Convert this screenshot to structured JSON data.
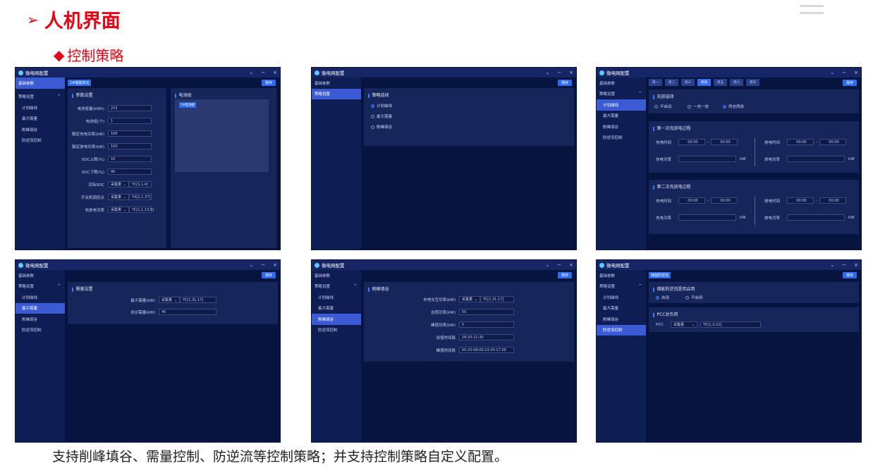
{
  "heading": {
    "arrow": "➢",
    "title": "人机界面"
  },
  "subheading": {
    "diamond": "◆",
    "title": "控制策略"
  },
  "caption": "支持削峰填谷、需量控制、防逆流等控制策略；并支持控制策略自定义配置。",
  "window": {
    "title": "微电网配置",
    "min": "−",
    "close": "×",
    "collapse": "⌄"
  },
  "sidebar": {
    "basic": "基础参数",
    "strategy": "策略设置",
    "plan": "计划曲线",
    "demand": "最大需量",
    "peak": "削峰填谷",
    "reverse": "防逆流控制"
  },
  "save": "保存",
  "w1": {
    "tag": "1#储能单元",
    "param_title": "参数设置",
    "group_title": "电池组",
    "group_btn": "1#电池组",
    "fields": [
      {
        "label": "电池容量(kWh)",
        "value": "215"
      },
      {
        "label": "电池组(个)",
        "value": "1"
      },
      {
        "label": "额定充电功率(kW)",
        "value": "100"
      },
      {
        "label": "额定放电功率(kW)",
        "value": "100"
      },
      {
        "label": "SOC上限(%)",
        "value": "10"
      },
      {
        "label": "SOC下限(%)",
        "value": "90"
      }
    ],
    "selects": [
      {
        "label": "实际SOC",
        "type": "采集量",
        "value": "YC[1,1,4]"
      },
      {
        "label": "开关机调控点",
        "type": "采集量",
        "value": "YX[1,1,37]"
      },
      {
        "label": "充放电功率",
        "type": "采集量",
        "value": "YC[1,1,13,5]"
      }
    ]
  },
  "w2": {
    "title": "策略选择",
    "options": [
      "计划曲线",
      "最大需量",
      "削峰填谷"
    ]
  },
  "w3": {
    "tabs": [
      "周一",
      "周二",
      "周三",
      "周四",
      "周五",
      "周六",
      "周日"
    ],
    "mode_title": "充放选择",
    "modes": [
      "不启动",
      "一充一放",
      "两充两放"
    ],
    "first_title": "第一次充放电过程",
    "second_title": "第二次充放电过程",
    "charge_time": "充电时间",
    "discharge_time": "放电时间",
    "charge_power": "充电功率",
    "discharge_power": "放电功率",
    "time": "00:00",
    "dash": "-",
    "unit": "kW"
  },
  "w4": {
    "title": "需量设置",
    "max_label": "最大需量(kW)",
    "max_type": "采集量",
    "max_value": "YC[1,31,17]",
    "agree_label": "协议需量(kW)",
    "agree_value": "40"
  },
  "w5": {
    "title": "削峰填谷",
    "fields": [
      {
        "label": "市电交互功率(kW)",
        "type": "采集量",
        "value": "YC[1,31,17]"
      },
      {
        "label": "谷值功率(kW)",
        "value": "50"
      },
      {
        "label": "峰值功率(kW)",
        "value": "5"
      },
      {
        "label": "谷值时间段",
        "value": "18:20-21:30"
      },
      {
        "label": "峰值时间段",
        "value": "00:20-08:00,13:20-17:00"
      }
    ]
  },
  "w6": {
    "tag": "储能防逆流",
    "enable_title": "储能防逆流是否启用",
    "enable": "启用",
    "disable": "不启用",
    "pcc_title": "PCC总负荷",
    "pcc_label": "PCC",
    "pcc_type": "采集量",
    "pcc_value": "YC[1,3,22]"
  }
}
